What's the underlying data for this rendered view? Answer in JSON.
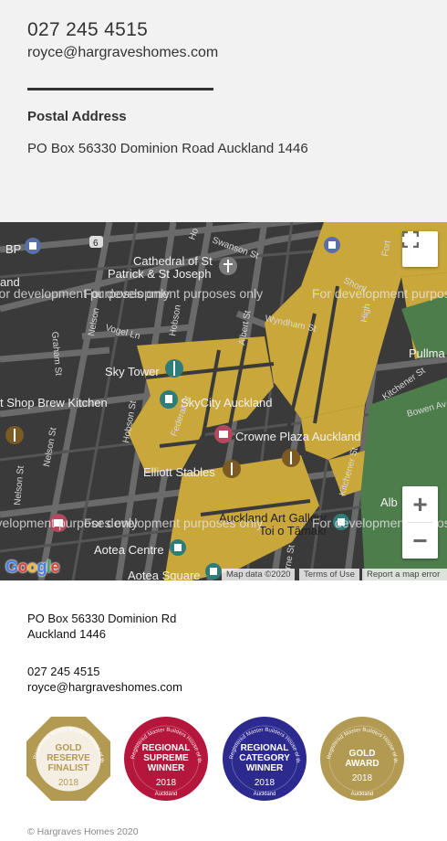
{
  "contact": {
    "phone": "027 245 4515",
    "email": "royce@hargraveshomes.com",
    "postal_label": "Postal Address",
    "postal_address": "PO Box 56330 Dominion Road Auckland 1446"
  },
  "map": {
    "dev_watermark": "For development purposes only",
    "places": {
      "cathedral_1": "Cathedral of St",
      "cathedral_2": "Patrick & St Joseph",
      "sky_tower": "Sky Tower",
      "skycity": "SkyCity Auckland",
      "brew_kitchen": "t Shop Brew Kitchen",
      "crowne": "Crowne Plaza Auckland",
      "elliott": "Elliott Stables",
      "art_gallery_1": "Auckland Art Gallery",
      "art_gallery_2": "Toi o Tāmaki",
      "aotea_centre": "Aotea Centre",
      "aotea_square": "Aotea Square",
      "alb": "Alb",
      "pullma": "Pullma",
      "bp": "BP",
      "route": "6",
      "land": "and"
    },
    "streets": {
      "swanson": "Swanson St",
      "hobson_top": "Hobson",
      "nelson_top": "Nelson",
      "graham": "Graham St",
      "vogel": "Vogel Ln",
      "wyndham": "Wyndham St",
      "albert": "Albert St",
      "high": "High",
      "shortland": "Shortl",
      "kitchener_top": "Kitchener St",
      "bowen": "Bowen Av",
      "hobson": "Hobson St",
      "federal": "Federal St",
      "nelson": "Nelson St",
      "nelson_low": "Nelson St",
      "kitchener": "Kitchener St",
      "lorne": "rne St",
      "fort": "Fort",
      "ho": "Ho"
    },
    "zoom_in": "+",
    "zoom_out": "−",
    "google": "Google",
    "map_data": "Map data ©2020",
    "terms": "Terms of Use",
    "report": "Report a map error"
  },
  "footer": {
    "address_line1": "PO Box 56330 Dominion Rd",
    "address_line2": "Auckland 1446",
    "phone": "027 245 4515",
    "email": "royce@hargraveshomes.com",
    "copyright": "© Hargraves Homes 2020"
  },
  "badges": [
    {
      "arc": "Registered Master Builders House of the Year",
      "lines": [
        "GOLD",
        "RESERVE",
        "FINALIST"
      ],
      "year": "2018",
      "sub": "",
      "color": "#b39a52",
      "inner": "#f4efe2",
      "text_color": "#b39a52"
    },
    {
      "arc": "Registered Master Builders House of the Year",
      "lines": [
        "REGIONAL",
        "SUPREME",
        "WINNER"
      ],
      "year": "2018",
      "sub": "Auckland",
      "color": "#b5163b",
      "inner": "#b5163b",
      "text_color": "#ffffff"
    },
    {
      "arc": "Registered Master Builders House of the Year",
      "lines": [
        "REGIONAL",
        "CATEGORY",
        "WINNER"
      ],
      "year": "2018",
      "sub": "Auckland",
      "color": "#2d2a8f",
      "inner": "#2d2a8f",
      "text_color": "#ffffff"
    },
    {
      "arc": "Registered Master Builders House of the Year",
      "lines": [
        "GOLD",
        "AWARD"
      ],
      "year": "2018",
      "sub": "Auckland",
      "color": "#b39a52",
      "inner": "#b39a52",
      "text_color": "#ffffff"
    }
  ],
  "colors": {
    "map_bg": "#3c3c3c",
    "building": "#c9a73a",
    "park": "#4e7d4c"
  }
}
